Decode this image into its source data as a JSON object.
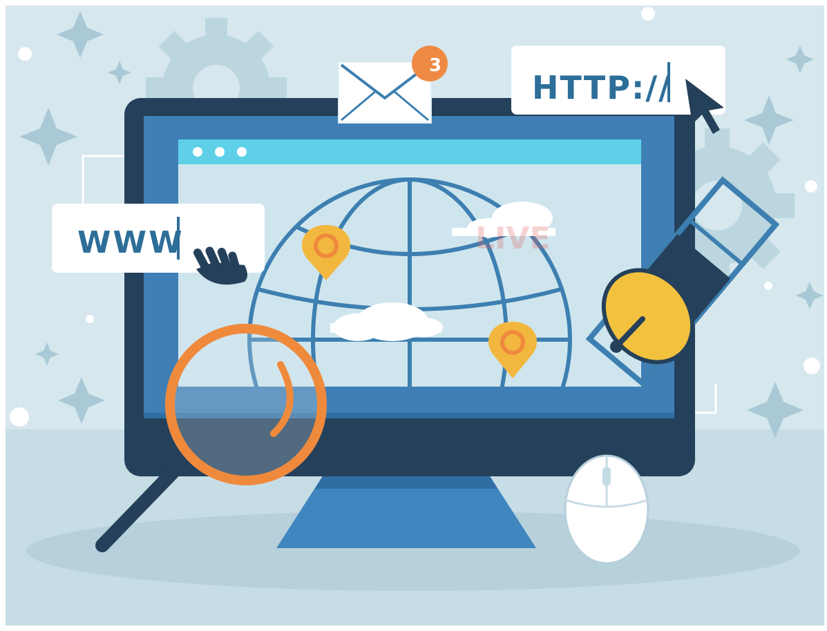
{
  "url_bar": {
    "text": "HTTP://"
  },
  "www_bar": {
    "text": "WWW"
  },
  "mail": {
    "badge_count": "3"
  },
  "watermark": {
    "text": "LIVE"
  },
  "colors": {
    "background": "#d6e7ee",
    "monitor_frame": "#25405a",
    "screen_blue": "#3f7fb5",
    "browser_bar": "#5ed0e8",
    "globe_line": "#3d7fb0",
    "pin": "#f2b73f",
    "magnifier": "#ef8a3d",
    "badge": "#ee8a44",
    "text_blue": "#2d6e99"
  }
}
